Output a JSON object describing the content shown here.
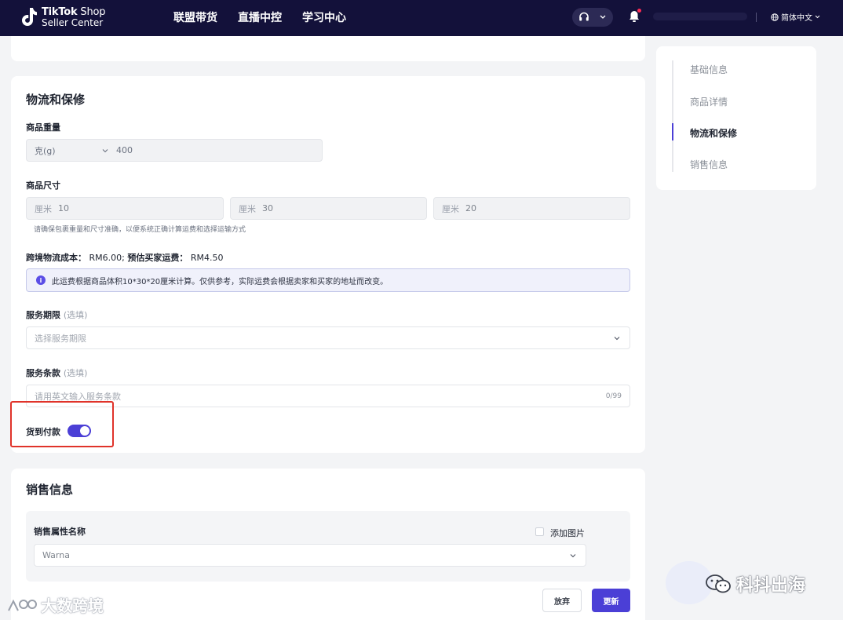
{
  "header": {
    "logo_line1_bold": "TikTok",
    "logo_line1_rest": " Shop",
    "logo_line2": "Seller Center",
    "nav": [
      "联盟带货",
      "直播中控",
      "学习中心"
    ],
    "language": "简体中文"
  },
  "logistics": {
    "title": "物流和保修",
    "weight_label": "商品重量",
    "weight_unit": "克(g)",
    "weight_value": "400",
    "size_label": "商品尺寸",
    "size_unit": "厘米",
    "size_values": [
      "10",
      "30",
      "20"
    ],
    "size_hint": "请确保包裹重量和尺寸准确，以便系统正确计算运费和选择运输方式",
    "cost_label": "跨境物流成本：",
    "cost_value": "RM6.00;",
    "buyer_fee_label": "预估买家运费：",
    "buyer_fee_value": "RM4.50",
    "notice": "此运费根据商品体积10*30*20厘米计算。仅供参考，实际运费会根据卖家和买家的地址而改变。",
    "service_period_label": "服务期限",
    "optional": "(选填)",
    "service_period_placeholder": "选择服务期限",
    "service_terms_label": "服务条款",
    "service_terms_placeholder": "请用英文输入服务条款",
    "service_terms_counter": "0/99",
    "cod_label": "货到付款",
    "cod_enabled": true
  },
  "anchors": {
    "items": [
      "基础信息",
      "商品详情",
      "物流和保修",
      "销售信息"
    ],
    "active_index": 2
  },
  "sales": {
    "title": "销售信息",
    "attr_label": "销售属性名称",
    "add_image": "添加图片",
    "attr_value": "Warna"
  },
  "actions": {
    "discard": "放弃",
    "update": "更新"
  },
  "watermarks": {
    "left": "大数跨境",
    "right": "科抖出海"
  },
  "colors": {
    "nav_bg": "#13113a",
    "primary": "#4b3fd6",
    "highlight": "#e0332a"
  }
}
